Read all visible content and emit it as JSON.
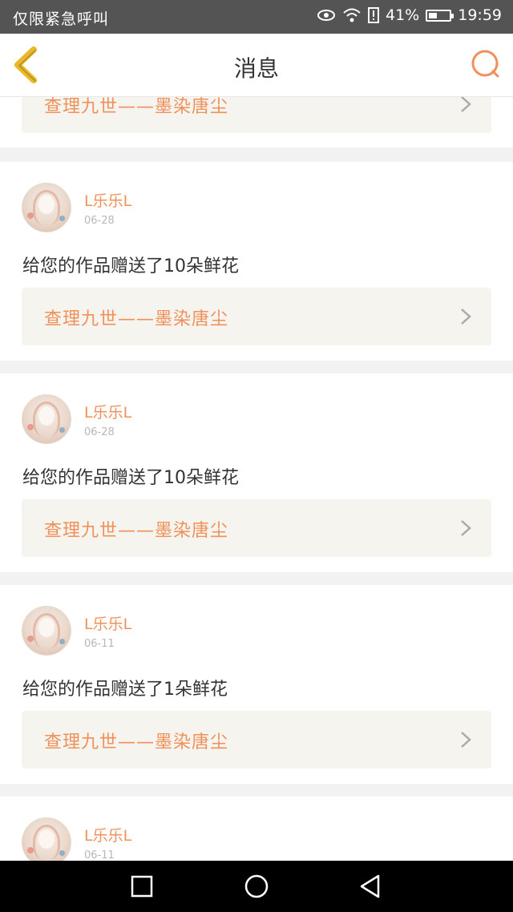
{
  "status_bar": {
    "left_text": "仅限紧急呼叫",
    "battery": "41%",
    "battery_level": 0.41,
    "time": "19:59"
  },
  "header": {
    "title": "消息"
  },
  "colors": {
    "accent": "#f0905a",
    "back_icon": "#e9b92a"
  },
  "top_partial": {
    "work_title": "查理九世——墨染唐尘"
  },
  "messages": [
    {
      "user": "L乐乐L",
      "date": "06-28",
      "text": "给您的作品赠送了10朵鲜花",
      "work_title": "查理九世——墨染唐尘"
    },
    {
      "user": "L乐乐L",
      "date": "06-28",
      "text": "给您的作品赠送了10朵鲜花",
      "work_title": "查理九世——墨染唐尘"
    },
    {
      "user": "L乐乐L",
      "date": "06-11",
      "text": "给您的作品赠送了1朵鲜花",
      "work_title": "查理九世——墨染唐尘"
    },
    {
      "user": "L乐乐L",
      "date": "06-11"
    }
  ]
}
